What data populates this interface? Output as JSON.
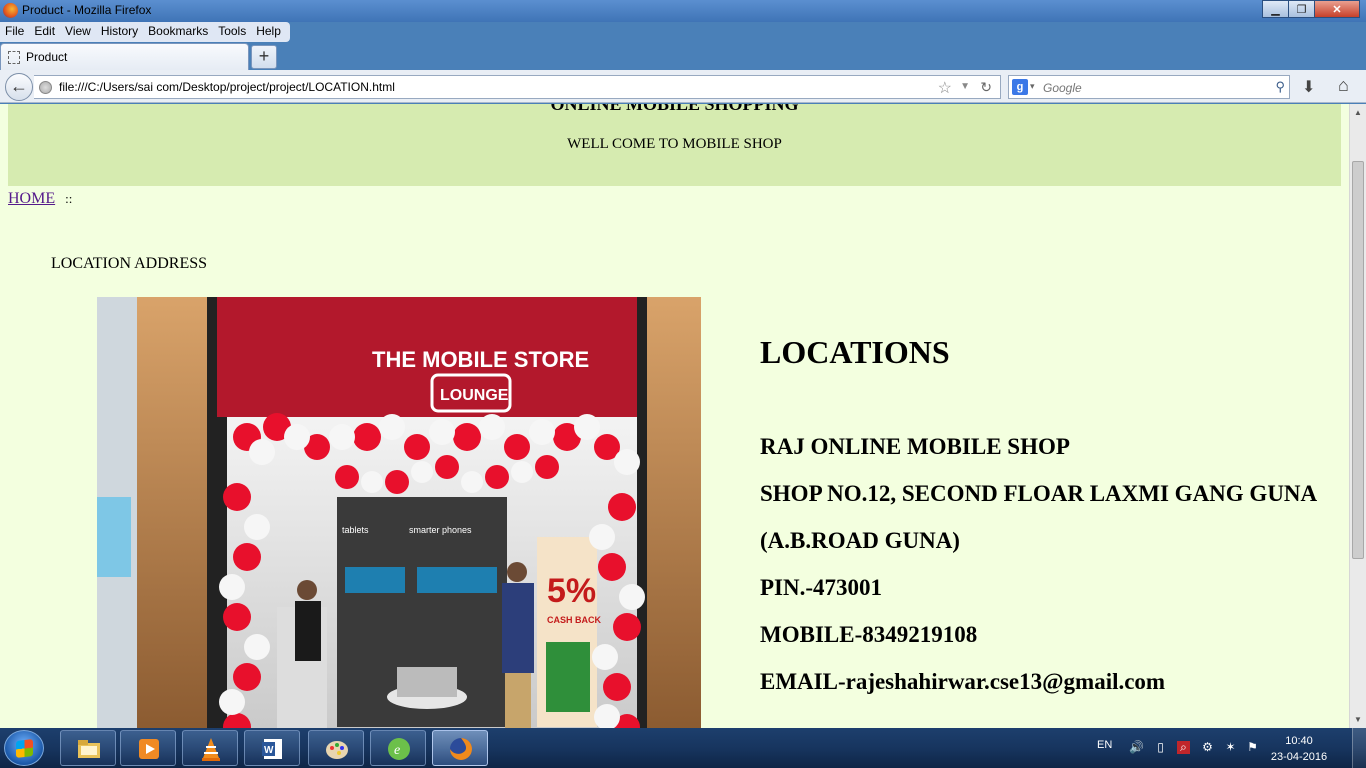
{
  "window": {
    "title": "Product - Mozilla Firefox",
    "buttons": {
      "minimize": "▁",
      "maximize": "❐",
      "close": "✕"
    }
  },
  "menubar": {
    "items": [
      {
        "label": "File"
      },
      {
        "label": "Edit"
      },
      {
        "label": "View"
      },
      {
        "label": "History"
      },
      {
        "label": "Bookmarks"
      },
      {
        "label": "Tools"
      },
      {
        "label": "Help"
      }
    ]
  },
  "tabs": {
    "active_label": "Product",
    "new_tab_label": "+"
  },
  "navbar": {
    "url": "file:///C:/Users/sai com/Desktop/project/project/LOCATION.html",
    "search_placeholder": "Google",
    "search_engine_label": "g"
  },
  "page": {
    "site_title": "ONLINE MOBILE SHOPPING",
    "welcome": "WELL COME TO MOBILE SHOP",
    "breadcrumb_home": "HOME",
    "breadcrumb_sep": "::",
    "section_label": "LOCATION ADDRESS",
    "photo": {
      "store_sign_line1": "THE MOBILE STORE",
      "store_sign_line2": "LOUNGE",
      "panel_left": "tablets",
      "panel_right": "smarter phones",
      "offer_big": "5%",
      "offer_small": "CASH BACK"
    },
    "locations_heading": "LOCATIONS",
    "address_lines": [
      "RAJ ONLINE MOBILE SHOP",
      "SHOP NO.12, SECOND FLOAR LAXMI GANG GUNA",
      "(A.B.ROAD GUNA)",
      "PIN.-473001",
      "MOBILE-8349219108",
      "EMAIL-rajeshahirwar.cse13@gmail.com"
    ]
  },
  "taskbar": {
    "pinned": [
      "explorer-icon",
      "media-player-icon",
      "vlc-icon",
      "word-icon",
      "paint-icon",
      "dreamweaver-icon",
      "firefox-icon"
    ],
    "language": "EN",
    "time": "10:40",
    "date": "23-04-2016"
  },
  "colors": {
    "page_bg": "#f3ffdf",
    "header_band": "#d6ebb0",
    "link_visited": "#551a8b"
  }
}
